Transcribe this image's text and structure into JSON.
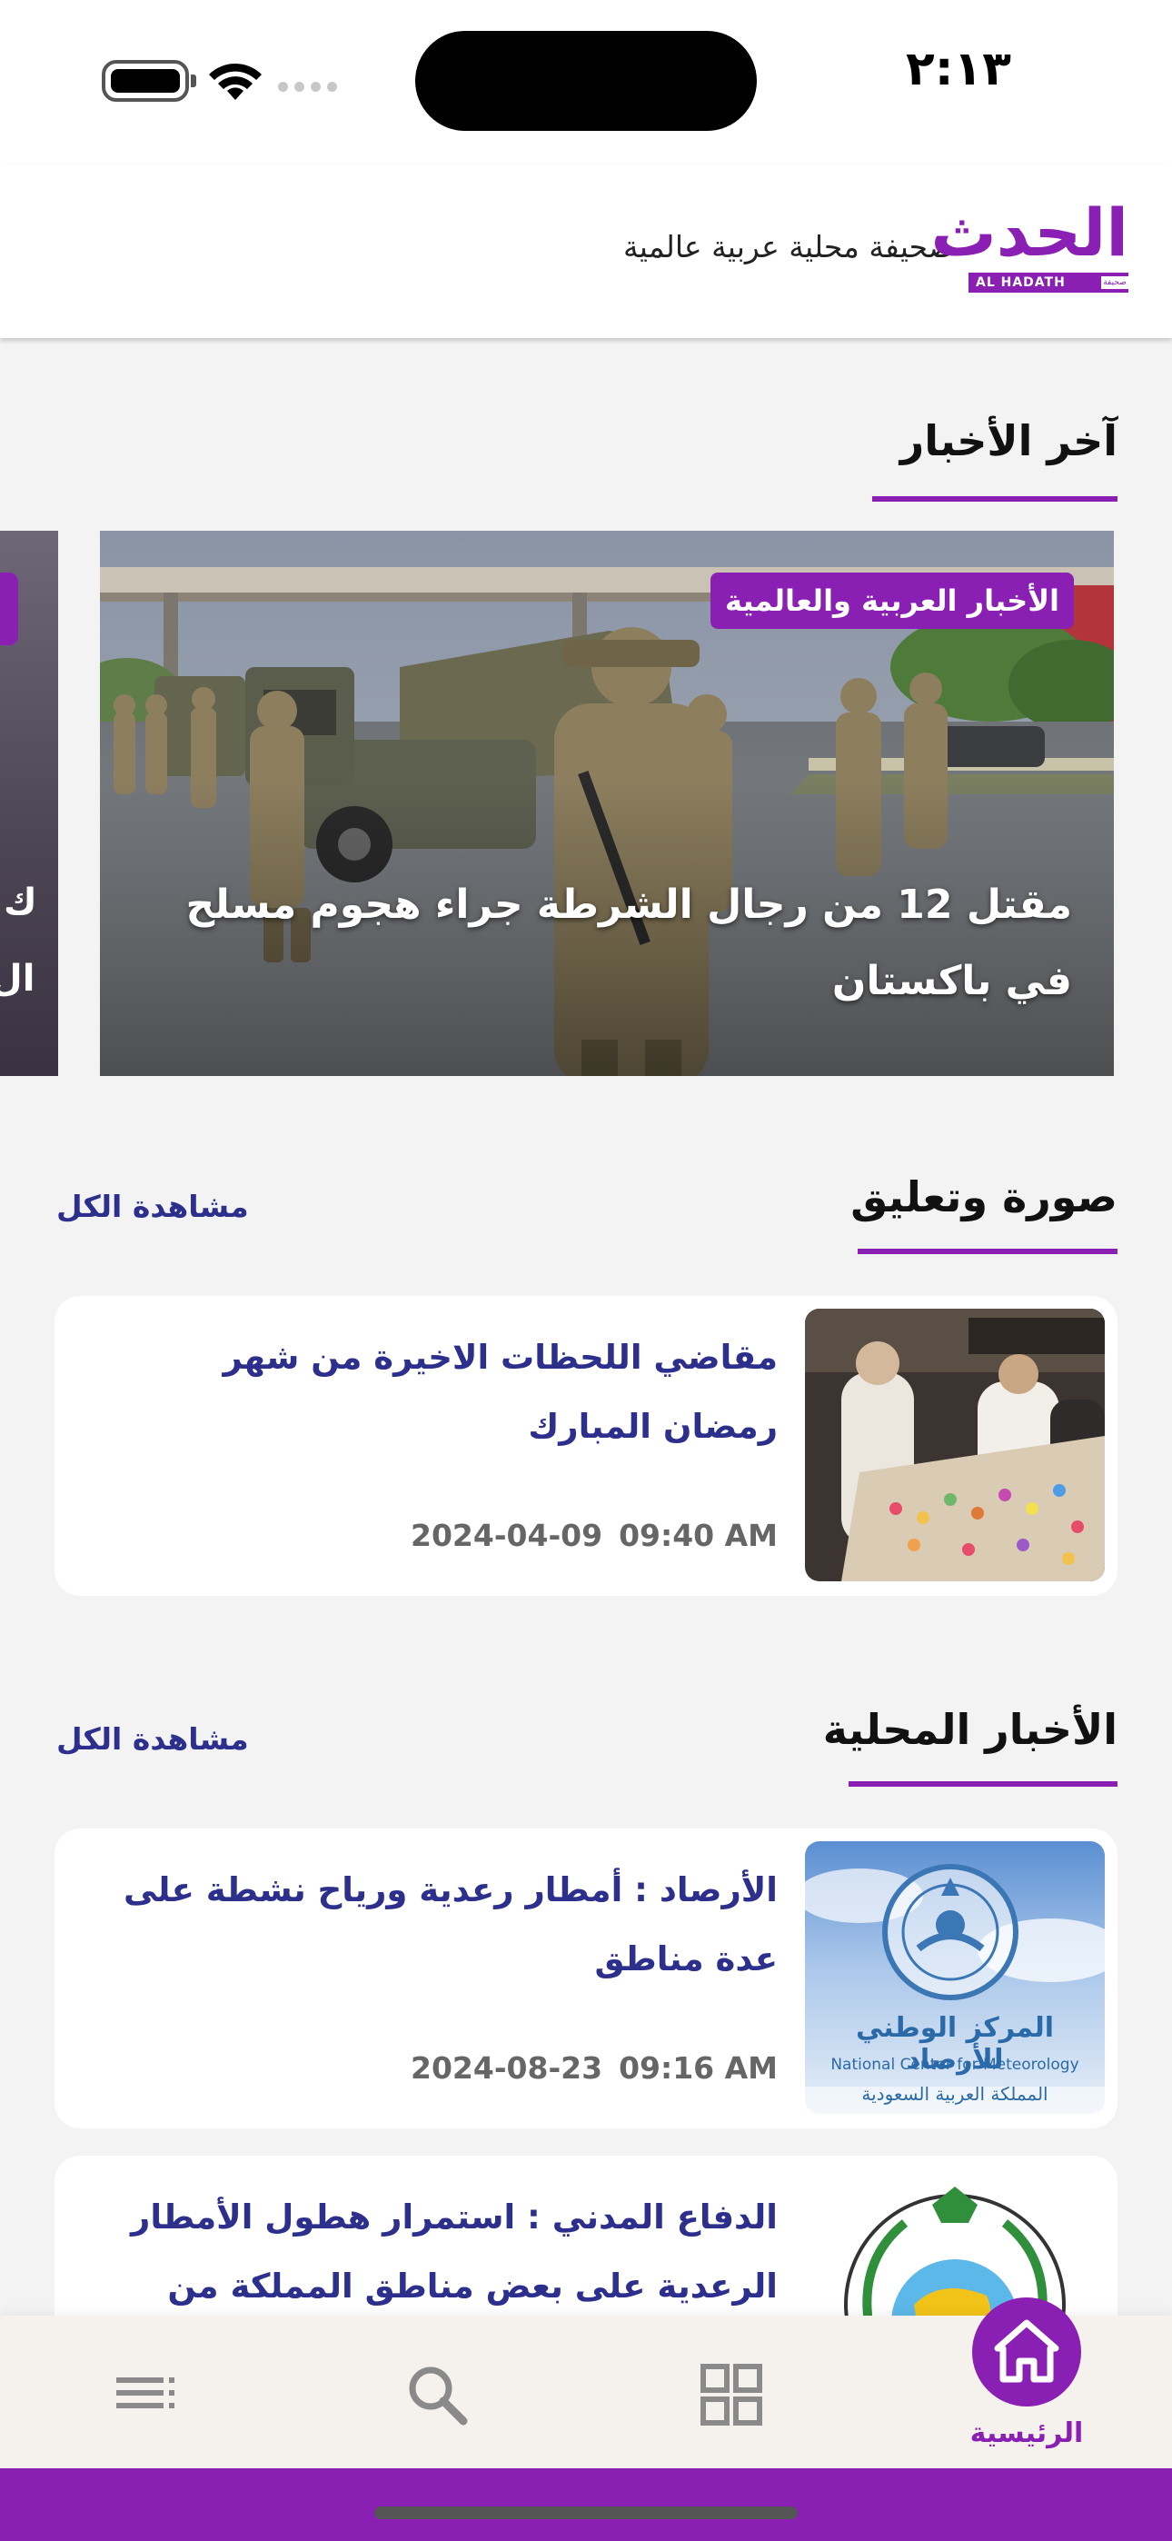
{
  "status_bar": {
    "time": "٢:١٣"
  },
  "header": {
    "logo_text": "الحدث",
    "logo_subtext": "AL HADATH",
    "logo_tag": "صحيفة",
    "tagline": "صحيفة محلية عربية عالمية"
  },
  "latest_news": {
    "section_title": "آخر الأخبار",
    "side_card_text": [
      "ك",
      "ال"
    ],
    "hero": {
      "category": "الأخبار العربية والعالمية",
      "headline": "مقتل 12 من رجال الشرطة جراء هجوم مسلح في باكستان"
    }
  },
  "photo_comment": {
    "section_title": "صورة وتعليق",
    "see_all": "مشاهدة الكل",
    "items": [
      {
        "title": "مقاضي اللحظات الاخيرة من شهر رمضان المبارك",
        "time": "09:40 AM",
        "date": "2024-04-09"
      }
    ]
  },
  "local_news": {
    "section_title": "الأخبار المحلية",
    "see_all": "مشاهدة الكل",
    "items": [
      {
        "title": "الأرصاد : أمطار رعدية ورياح نشطة على عدة مناطق",
        "time": "09:16 AM",
        "date": "2024-08-23",
        "thumb_text_ar": "المركز الوطني للأرصاد",
        "thumb_text_en": "National Center for Meteorology",
        "thumb_text_ar2": "المملكة العربية السعودية"
      },
      {
        "title": "الدفاع المدني : استمرار هطول الأمطار الرعدية على بعض مناطق المملكة من يوم ..."
      }
    ]
  },
  "bottom_nav": {
    "home_label": "الرئيسية",
    "items": [
      "home-icon",
      "grid-icon",
      "search-icon",
      "menu-icon"
    ]
  },
  "colors": {
    "brand": "#8a1fb4",
    "link": "#2c2f8c"
  }
}
